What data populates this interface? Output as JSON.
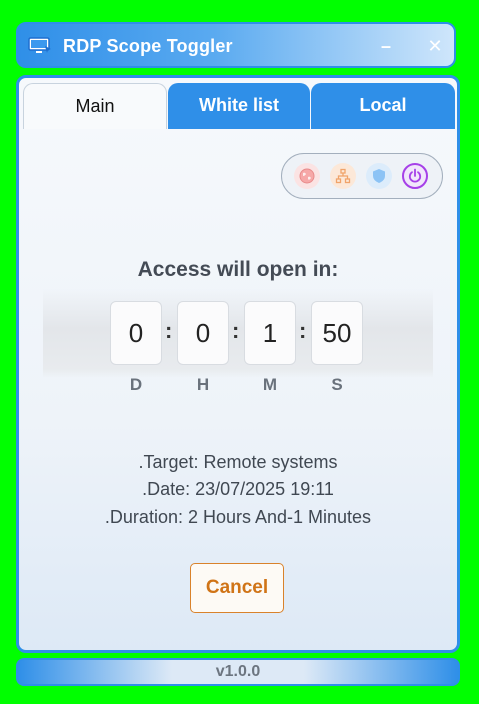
{
  "window": {
    "title": "RDP Scope Toggler",
    "minimize_label": "–",
    "close_label": "✕"
  },
  "tabs": [
    {
      "label": "Main",
      "active": true
    },
    {
      "label": "White list",
      "active": false
    },
    {
      "label": "Local",
      "active": false
    }
  ],
  "status_icons": [
    "globe-icon",
    "network-icon",
    "shield-icon",
    "power-icon"
  ],
  "countdown": {
    "title": "Access will open in:",
    "days": "0",
    "hours": "0",
    "minutes": "1",
    "seconds": "50",
    "separator": ":",
    "labels": {
      "days": "D",
      "hours": "H",
      "minutes": "M",
      "seconds": "S"
    }
  },
  "info": {
    "target": ".Target: Remote systems",
    "date": ".Date: 23/07/2025 19:11",
    "duration": ".Duration: 2 Hours And-1 Minutes"
  },
  "cancel_label": "Cancel",
  "footer": {
    "version": "v1.0.0"
  },
  "colors": {
    "accent": "#2f8fe8",
    "cancel": "#d9822b",
    "power_active": "#a640e8",
    "chroma_background": "#00ff00"
  }
}
